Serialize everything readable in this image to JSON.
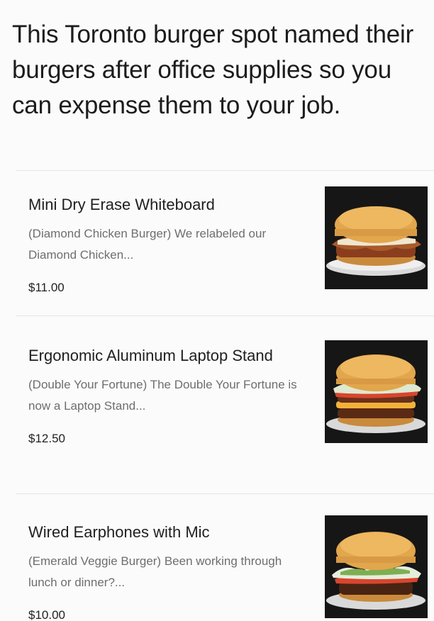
{
  "caption": "This Toronto burger spot named their burgers after office supplies so you can expense them to your job.",
  "menu": {
    "items": [
      {
        "name": "Mini Dry Erase Whiteboard",
        "description": "(Diamond Chicken Burger) We relabeled our Diamond Chicken...",
        "price": "$11.00",
        "image": "chicken-burger-photo"
      },
      {
        "name": "Ergonomic Aluminum Laptop Stand",
        "description": "(Double Your Fortune) The Double Your Fortune is now a Laptop Stand...",
        "price": "$12.50",
        "image": "double-burger-photo"
      },
      {
        "name": "Wired Earphones with Mic",
        "description": "(Emerald Veggie Burger) Been working through lunch or dinner?...",
        "price": "$10.00",
        "image": "veggie-burger-photo"
      }
    ]
  }
}
